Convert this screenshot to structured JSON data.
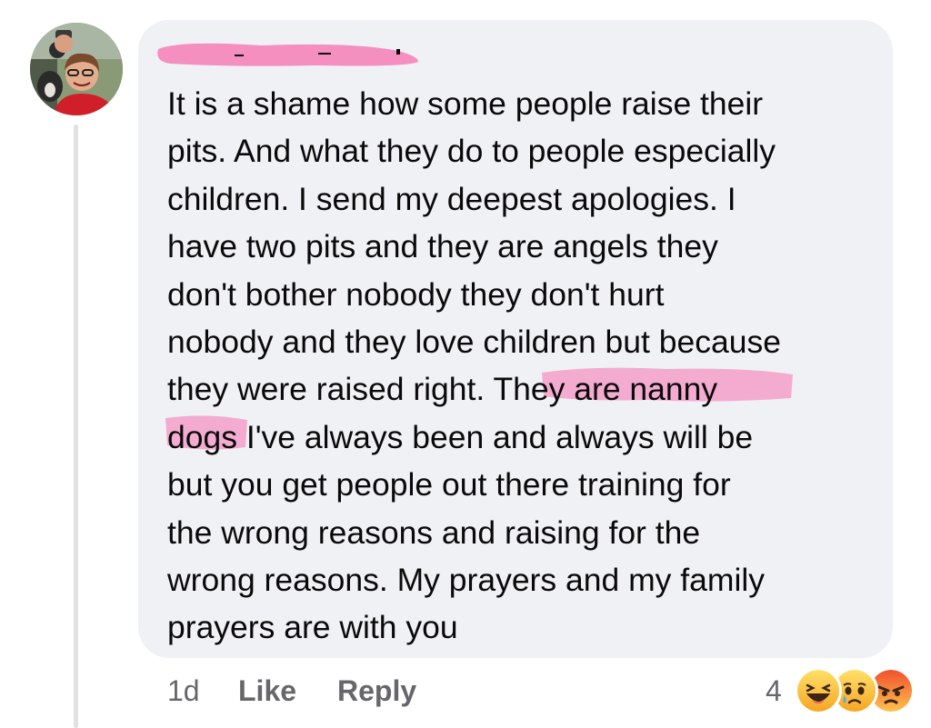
{
  "comment": {
    "author": "",
    "text_lines": [
      "It is a shame how some people raise their",
      "pits. And what they do to people especially",
      "children. I send my deepest apologies. I",
      "have two pits and they are angels they",
      "don't bother nobody they don't hurt",
      "nobody and they love children but because",
      "they were raised right. They are nanny",
      "dogs I've always been and always will be",
      "but you get people out there training for",
      "the wrong reasons and raising for the",
      "wrong reasons. My prayers and my family",
      "prayers are with you"
    ]
  },
  "footer": {
    "time": "1d",
    "like_label": "Like",
    "reply_label": "Reply",
    "reaction_count": "4",
    "reactions": [
      "haha-icon",
      "sad-icon",
      "angry-icon"
    ]
  },
  "colors": {
    "bubble": "#f0f1f5",
    "highlight": "#f48fc0",
    "meta_text": "#65676b"
  }
}
